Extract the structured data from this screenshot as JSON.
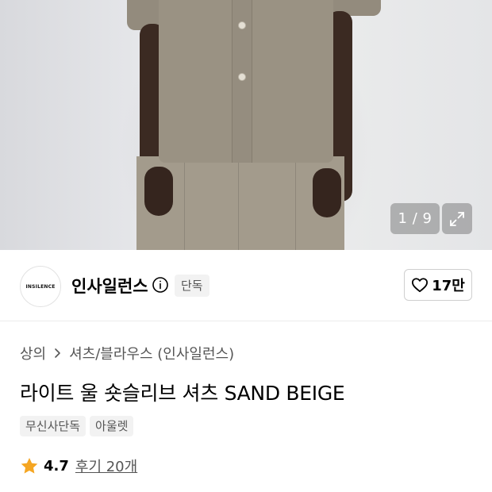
{
  "image_viewer": {
    "counter": "1 / 9",
    "icons": {
      "expand": "expand-arrows-icon"
    }
  },
  "brand": {
    "logo_text": "INSILENCE",
    "name": "인사일런스",
    "exclusive_badge": "단독",
    "like_count": "17만",
    "icons": {
      "info": "info-circle-icon",
      "like": "heart-outline-icon"
    }
  },
  "breadcrumb": {
    "category": "상의",
    "subcategory": "셔츠/블라우스 (인사일런스)",
    "icons": {
      "separator": "chevron-right-icon"
    }
  },
  "product": {
    "title": "라이트 울 숏슬리브 셔츠 SAND BEIGE",
    "tags": [
      "무신사단독",
      "아울렛"
    ]
  },
  "rating": {
    "score": "4.7",
    "reviews": "후기 20개",
    "star_color": "#f5a623",
    "icons": {
      "star": "star-filled-icon"
    }
  }
}
